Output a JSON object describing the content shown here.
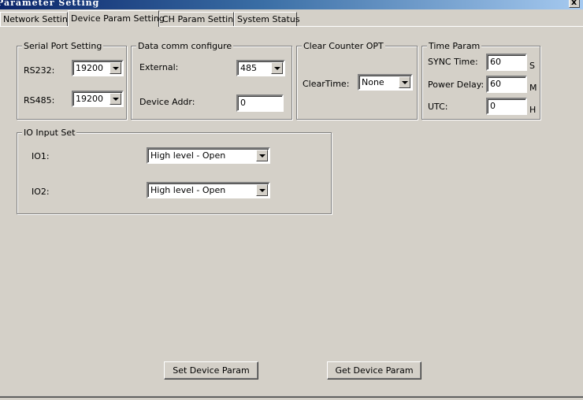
{
  "window": {
    "title": "Parameter Setting",
    "close_glyph": "x"
  },
  "tabs": [
    {
      "label": "Network Setting"
    },
    {
      "label": "Device Param Setting"
    },
    {
      "label": "CH Param Setting"
    },
    {
      "label": "System Status"
    }
  ],
  "active_tab": "Device Param Setting",
  "serial_port": {
    "title": "Serial Port Setting",
    "rs232_label": "RS232:",
    "rs232_value": "19200",
    "rs485_label": "RS485:",
    "rs485_value": "19200"
  },
  "data_comm": {
    "title": "Data comm configure",
    "external_label": "External:",
    "external_value": "485",
    "addr_label": "Device Addr:",
    "addr_value": "0"
  },
  "clear_counter": {
    "title": "Clear Counter OPT",
    "cleartime_label": "ClearTime:",
    "cleartime_value": "None"
  },
  "time_param": {
    "title": "Time Param",
    "sync_label": "SYNC Time:",
    "sync_value": "60",
    "sync_unit": "S",
    "delay_label": "Power Delay:",
    "delay_value": "60",
    "delay_unit": "M",
    "utc_label": "UTC:",
    "utc_value": "0",
    "utc_unit": "H"
  },
  "io_input": {
    "title": "IO Input Set",
    "io1_label": "IO1:",
    "io1_value": "High level - Open",
    "io2_label": "IO2:",
    "io2_value": "High level - Open"
  },
  "buttons": {
    "set_label": "Set Device Param",
    "get_label": "Get Device Param"
  },
  "icons": {
    "dropdown": "chevron-down-icon",
    "close": "close-icon"
  }
}
